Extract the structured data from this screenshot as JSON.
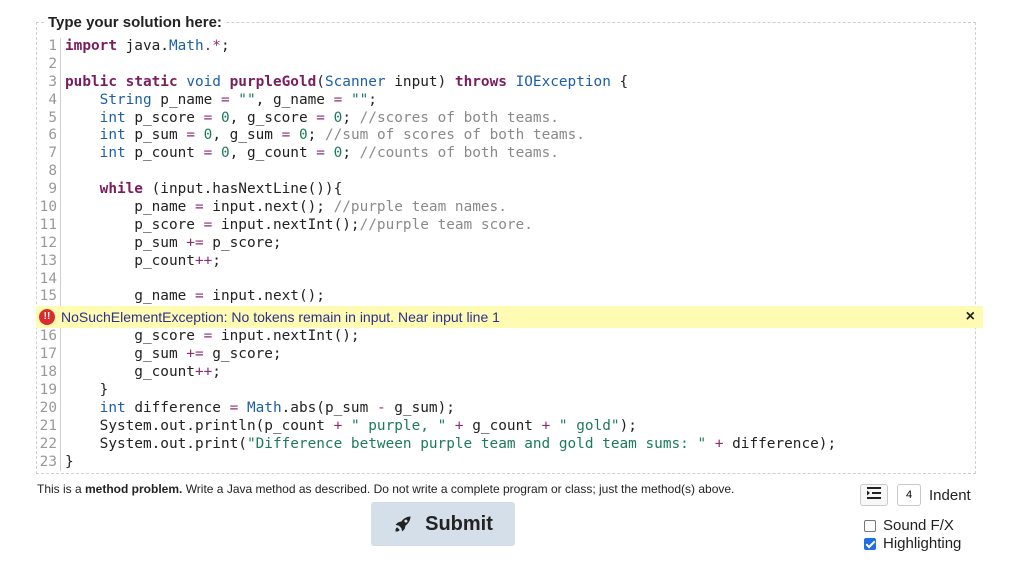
{
  "editor": {
    "label": "Type your solution here:",
    "lines_before_error": [
      {
        "n": "1"
      },
      {
        "n": "2"
      },
      {
        "n": "3"
      },
      {
        "n": "4"
      },
      {
        "n": "5"
      },
      {
        "n": "6"
      },
      {
        "n": "7"
      },
      {
        "n": "8"
      },
      {
        "n": "9"
      },
      {
        "n": "10"
      },
      {
        "n": "11"
      },
      {
        "n": "12"
      },
      {
        "n": "13"
      },
      {
        "n": "14"
      },
      {
        "n": "15"
      }
    ],
    "lines_after_error": [
      {
        "n": "16"
      },
      {
        "n": "17"
      },
      {
        "n": "18"
      },
      {
        "n": "19"
      },
      {
        "n": "20"
      },
      {
        "n": "21"
      },
      {
        "n": "22"
      },
      {
        "n": "23"
      }
    ],
    "code_before_error": [
      [
        [
          "kw",
          "import"
        ],
        [
          "id",
          " java."
        ],
        [
          "cls",
          "Math"
        ],
        [
          "op",
          ".*"
        ],
        [
          "id",
          ";"
        ]
      ],
      [],
      [
        [
          "kw",
          "public"
        ],
        [
          "id",
          " "
        ],
        [
          "kw",
          "static"
        ],
        [
          "id",
          " "
        ],
        [
          "ty",
          "void"
        ],
        [
          "id",
          " "
        ],
        [
          "kw",
          "purpleGold"
        ],
        [
          "id",
          "("
        ],
        [
          "cls",
          "Scanner"
        ],
        [
          "id",
          " input) "
        ],
        [
          "kw",
          "throws"
        ],
        [
          "id",
          " "
        ],
        [
          "cls",
          "IOException"
        ],
        [
          "id",
          " {"
        ]
      ],
      [
        [
          "id",
          "    "
        ],
        [
          "ty",
          "String"
        ],
        [
          "id",
          " p_name "
        ],
        [
          "op",
          "="
        ],
        [
          "id",
          " "
        ],
        [
          "str",
          "\"\""
        ],
        [
          "id",
          ", g_name "
        ],
        [
          "op",
          "="
        ],
        [
          "id",
          " "
        ],
        [
          "str",
          "\"\""
        ],
        [
          "id",
          ";"
        ]
      ],
      [
        [
          "id",
          "    "
        ],
        [
          "ty",
          "int"
        ],
        [
          "id",
          " p_score "
        ],
        [
          "op",
          "="
        ],
        [
          "id",
          " "
        ],
        [
          "num",
          "0"
        ],
        [
          "id",
          ", g_score "
        ],
        [
          "op",
          "="
        ],
        [
          "id",
          " "
        ],
        [
          "num",
          "0"
        ],
        [
          "id",
          "; "
        ],
        [
          "cm",
          "//scores of both teams."
        ]
      ],
      [
        [
          "id",
          "    "
        ],
        [
          "ty",
          "int"
        ],
        [
          "id",
          " p_sum "
        ],
        [
          "op",
          "="
        ],
        [
          "id",
          " "
        ],
        [
          "num",
          "0"
        ],
        [
          "id",
          ", g_sum "
        ],
        [
          "op",
          "="
        ],
        [
          "id",
          " "
        ],
        [
          "num",
          "0"
        ],
        [
          "id",
          "; "
        ],
        [
          "cm",
          "//sum of scores of both teams."
        ]
      ],
      [
        [
          "id",
          "    "
        ],
        [
          "ty",
          "int"
        ],
        [
          "id",
          " p_count "
        ],
        [
          "op",
          "="
        ],
        [
          "id",
          " "
        ],
        [
          "num",
          "0"
        ],
        [
          "id",
          ", g_count "
        ],
        [
          "op",
          "="
        ],
        [
          "id",
          " "
        ],
        [
          "num",
          "0"
        ],
        [
          "id",
          "; "
        ],
        [
          "cm",
          "//counts of both teams."
        ]
      ],
      [],
      [
        [
          "id",
          "    "
        ],
        [
          "kw",
          "while"
        ],
        [
          "id",
          " (input.hasNextLine()){"
        ]
      ],
      [
        [
          "id",
          "        p_name "
        ],
        [
          "op",
          "="
        ],
        [
          "id",
          " input.next(); "
        ],
        [
          "cm",
          "//purple team names."
        ]
      ],
      [
        [
          "id",
          "        p_score "
        ],
        [
          "op",
          "="
        ],
        [
          "id",
          " input.nextInt();"
        ],
        [
          "cm",
          "//purple team score."
        ]
      ],
      [
        [
          "id",
          "        p_sum "
        ],
        [
          "op",
          "+="
        ],
        [
          "id",
          " p_score;"
        ]
      ],
      [
        [
          "id",
          "        p_count"
        ],
        [
          "op",
          "++"
        ],
        [
          "id",
          ";"
        ]
      ],
      [],
      [
        [
          "id",
          "        g_name "
        ],
        [
          "op",
          "="
        ],
        [
          "id",
          " input.next();"
        ]
      ]
    ],
    "code_after_error": [
      [
        [
          "id",
          "        g_score "
        ],
        [
          "op",
          "="
        ],
        [
          "id",
          " input.nextInt();"
        ]
      ],
      [
        [
          "id",
          "        g_sum "
        ],
        [
          "op",
          "+="
        ],
        [
          "id",
          " g_score;"
        ]
      ],
      [
        [
          "id",
          "        g_count"
        ],
        [
          "op",
          "++"
        ],
        [
          "id",
          ";"
        ]
      ],
      [
        [
          "id",
          "    }"
        ]
      ],
      [
        [
          "id",
          "    "
        ],
        [
          "ty",
          "int"
        ],
        [
          "id",
          " difference "
        ],
        [
          "op",
          "="
        ],
        [
          "id",
          " "
        ],
        [
          "cls",
          "Math"
        ],
        [
          "id",
          ".abs(p_sum "
        ],
        [
          "op",
          "-"
        ],
        [
          "id",
          " g_sum);"
        ]
      ],
      [
        [
          "id",
          "    System.out.println(p_count "
        ],
        [
          "op",
          "+"
        ],
        [
          "id",
          " "
        ],
        [
          "str",
          "\" purple, \""
        ],
        [
          "id",
          " "
        ],
        [
          "op",
          "+"
        ],
        [
          "id",
          " g_count "
        ],
        [
          "op",
          "+"
        ],
        [
          "id",
          " "
        ],
        [
          "str",
          "\" gold\""
        ],
        [
          "id",
          ");"
        ]
      ],
      [
        [
          "id",
          "    System.out.print("
        ],
        [
          "str",
          "\"Difference between purple team and gold team sums: \""
        ],
        [
          "id",
          " "
        ],
        [
          "op",
          "+"
        ],
        [
          "id",
          " difference);"
        ]
      ],
      [
        [
          "id",
          "}"
        ]
      ]
    ],
    "error": {
      "icon": "!!",
      "message": "NoSuchElementException: No tokens remain in input. Near input line 1",
      "close": "×"
    }
  },
  "description": {
    "prefix": "This is a ",
    "bold": "method problem.",
    "suffix": " Write a Java method as described. Do not write a complete program or class; just the method(s) above."
  },
  "submit": {
    "label": "Submit",
    "icon": "rocket-icon"
  },
  "indent": {
    "value": "4",
    "label": "Indent"
  },
  "options": [
    {
      "label": "Sound F/X",
      "checked": false
    },
    {
      "label": "Highlighting",
      "checked": true
    }
  ],
  "colors": {
    "error_bg": "#fffbb3",
    "submit_bg": "#d5dfe9",
    "checkbox_accent": "#1f6fe0",
    "keyword": "#7a1d5e",
    "type": "#1d5fa6",
    "string": "#1e7a5a",
    "comment": "#8a8a8a"
  }
}
